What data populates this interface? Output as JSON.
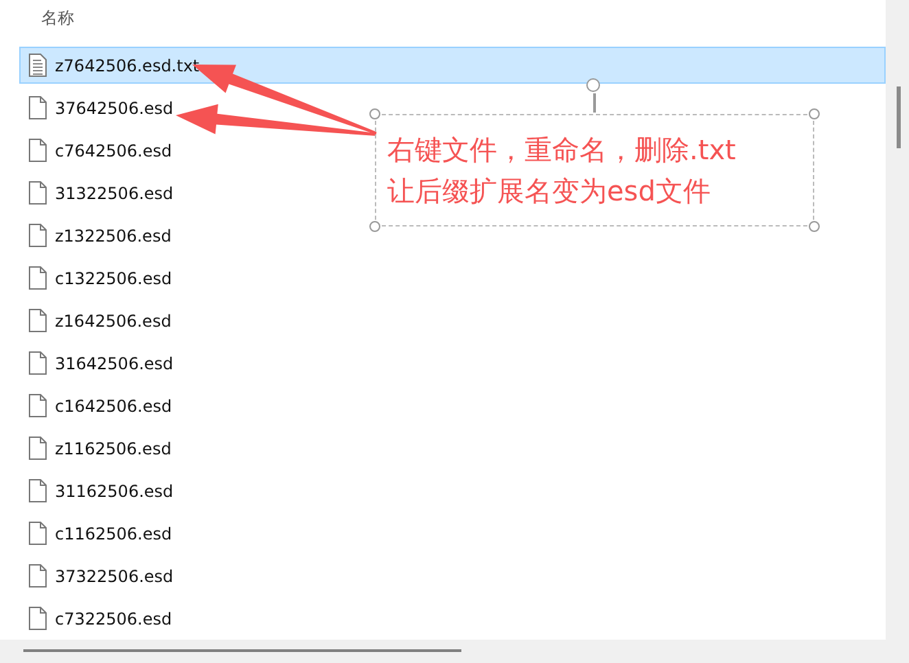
{
  "column_header": "名称",
  "files": [
    {
      "name": "z7642506.esd.txt",
      "kind": "text",
      "selected": true
    },
    {
      "name": "37642506.esd",
      "kind": "blank",
      "selected": false
    },
    {
      "name": "c7642506.esd",
      "kind": "blank",
      "selected": false
    },
    {
      "name": "31322506.esd",
      "kind": "blank",
      "selected": false
    },
    {
      "name": "z1322506.esd",
      "kind": "blank",
      "selected": false
    },
    {
      "name": "c1322506.esd",
      "kind": "blank",
      "selected": false
    },
    {
      "name": "z1642506.esd",
      "kind": "blank",
      "selected": false
    },
    {
      "name": "31642506.esd",
      "kind": "blank",
      "selected": false
    },
    {
      "name": "c1642506.esd",
      "kind": "blank",
      "selected": false
    },
    {
      "name": "z1162506.esd",
      "kind": "blank",
      "selected": false
    },
    {
      "name": "31162506.esd",
      "kind": "blank",
      "selected": false
    },
    {
      "name": "c1162506.esd",
      "kind": "blank",
      "selected": false
    },
    {
      "name": "37322506.esd",
      "kind": "blank",
      "selected": false
    },
    {
      "name": "c7322506.esd",
      "kind": "blank",
      "selected": false
    }
  ],
  "annotation": {
    "lines": [
      "右键文件，重命名，删除.txt",
      "让后缀扩展名变为esd文件"
    ]
  }
}
